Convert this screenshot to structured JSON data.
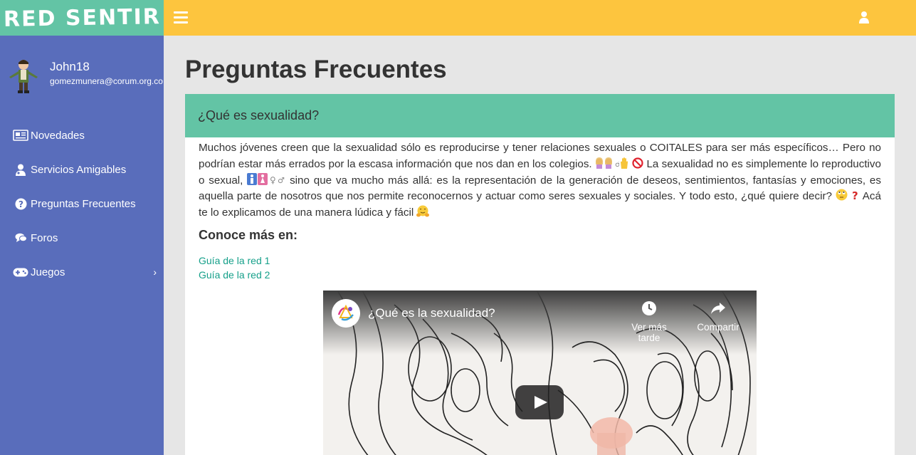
{
  "brand": {
    "name": "RED SENTIR"
  },
  "topbar": {
    "menu_icon": "hamburger-icon",
    "user_icon": "user-icon"
  },
  "colors": {
    "brand": "#63c4a5",
    "topbar": "#fdc53e",
    "sidebar": "#596dbb",
    "link": "#16a08a"
  },
  "user": {
    "name": "John18",
    "email": "gomezmunera@corum.org.co"
  },
  "sidebar": {
    "items": [
      {
        "label": "Novedades",
        "icon": "newspaper-icon"
      },
      {
        "label": "Servicios Amigables",
        "icon": "user-doctor-icon"
      },
      {
        "label": "Preguntas Frecuentes",
        "icon": "question-circle-icon"
      },
      {
        "label": "Foros",
        "icon": "comments-icon"
      },
      {
        "label": "Juegos",
        "icon": "gamepad-icon",
        "chevron": "›"
      }
    ]
  },
  "page": {
    "title": "Preguntas Frecuentes"
  },
  "faq": {
    "question": "¿Qué es sexualidad?",
    "text_1": "Muchos jóvenes creen que la sexualidad sólo es reproducirse y tener relaciones sexuales o COITALES para ser más específicos… Pero no podrían estar más errados por la escasa información que nos dan en los colegios.",
    "text_2": "La sexualidad no es simplemente lo reproductivo o sexual,",
    "text_3": "sino que va mucho más allá: es la representación de la generación de deseos, sentimientos, fantasías y emociones, es aquella parte de nosotros que nos permite reconocernos y actuar como seres sexuales y sociales. Y todo esto, ¿qué quiere decir?",
    "text_4": "Acá te lo explicamos de una manera lúdica y fácil",
    "subheading": "Conoce más en:",
    "links": [
      "Guía de la red 1",
      "Guía de la red 2"
    ]
  },
  "video": {
    "title": "¿Qué es la sexualidad?",
    "watch_later": "Ver más tarde",
    "share": "Compartir"
  }
}
